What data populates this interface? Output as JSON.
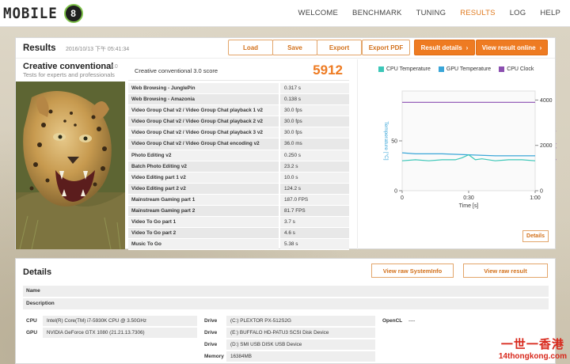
{
  "app": {
    "logo_text": "MOBILE",
    "logo_badge": "8"
  },
  "nav": [
    {
      "label": "WELCOME",
      "active": false
    },
    {
      "label": "BENCHMARK",
      "active": false
    },
    {
      "label": "TUNING",
      "active": false
    },
    {
      "label": "RESULTS",
      "active": true
    },
    {
      "label": "LOG",
      "active": false
    },
    {
      "label": "HELP",
      "active": false
    }
  ],
  "results": {
    "title": "Results",
    "date": "2016/10/13 下午 05:41:34",
    "buttons": {
      "load": "Load",
      "save": "Save",
      "export": "Export",
      "export_pdf": "Export PDF",
      "result_details": "Result details",
      "view_online": "View result online"
    },
    "test_name": "Creative conventional",
    "test_version": "3.0",
    "test_subtitle": "Tests for experts and professionals",
    "score_label": "Creative conventional 3.0 score",
    "score_value": "5912",
    "subtests": [
      {
        "name": "Web Browsing - JunglePin",
        "value": "0.317 s"
      },
      {
        "name": "Web Browsing - Amazonia",
        "value": "0.138 s"
      },
      {
        "name": "Video Group Chat v2 / Video Group Chat playback 1 v2",
        "value": "30.0 fps"
      },
      {
        "name": "Video Group Chat v2 / Video Group Chat playback 2 v2",
        "value": "30.0 fps"
      },
      {
        "name": "Video Group Chat v2 / Video Group Chat playback 3 v2",
        "value": "30.0 fps"
      },
      {
        "name": "Video Group Chat v2 / Video Group Chat encoding v2",
        "value": "36.0 ms"
      },
      {
        "name": "Photo Editing v2",
        "value": "0.250 s"
      },
      {
        "name": "Batch Photo Editing v2",
        "value": "23.2 s"
      },
      {
        "name": "Video Editing part 1 v2",
        "value": "10.0 s"
      },
      {
        "name": "Video Editing part 2 v2",
        "value": "124.2 s"
      },
      {
        "name": "Mainstream Gaming part 1",
        "value": "187.0 FPS"
      },
      {
        "name": "Mainstream Gaming part 2",
        "value": "81.7 FPS"
      },
      {
        "name": "Video To Go part 1",
        "value": "3.7 s"
      },
      {
        "name": "Video To Go part 2",
        "value": "4.6 s"
      },
      {
        "name": "Music To Go",
        "value": "5.38 s"
      }
    ],
    "details_button": "Details"
  },
  "chart_data": {
    "type": "line",
    "legend": [
      {
        "name": "CPU Temperature",
        "color": "#3cc7b8"
      },
      {
        "name": "GPU Temperature",
        "color": "#3aa6d8"
      },
      {
        "name": "CPU Clock",
        "color": "#8b4fb0"
      }
    ],
    "xlabel": "Time [s]",
    "ylabel_left": "Temperature [°C]",
    "ylabel_right": "Frequency [MHz]",
    "xlim": [
      0,
      1
    ],
    "x_ticks": [
      "0",
      "0:30",
      "1:00"
    ],
    "ylim_left": [
      0,
      100
    ],
    "y_ticks_left": [
      "0",
      "50"
    ],
    "ylim_right": [
      0,
      4400
    ],
    "y_ticks_right": [
      "0",
      "2000",
      "4000"
    ],
    "series": [
      {
        "name": "CPU Clock",
        "axis": "right",
        "x": [
          0,
          1
        ],
        "y": [
          3900,
          3900
        ]
      },
      {
        "name": "GPU Temperature",
        "axis": "left",
        "x": [
          0,
          0.1,
          0.3,
          0.5,
          0.7,
          0.9,
          1.0
        ],
        "y": [
          38,
          37,
          37,
          36,
          35,
          35,
          35
        ]
      },
      {
        "name": "CPU Temperature",
        "axis": "left",
        "x": [
          0,
          0.1,
          0.2,
          0.3,
          0.4,
          0.45,
          0.5,
          0.55,
          0.6,
          0.7,
          0.8,
          0.9,
          1.0
        ],
        "y": [
          30,
          31,
          30,
          31,
          31,
          33,
          36,
          31,
          32,
          30,
          31,
          31,
          30
        ]
      }
    ]
  },
  "details": {
    "title": "Details",
    "btn_systeminfo": "View raw SystemInfo",
    "btn_result": "View raw result",
    "name_label": "Name",
    "desc_label": "Description",
    "cpu_label": "CPU",
    "cpu_value": "Intel(R) Core(TM) i7-5930K CPU @ 3.50GHz",
    "gpu_label": "GPU",
    "gpu_value": "NVIDIA GeForce GTX 1080 (21.21.13.7306)",
    "drives_label": "Drive",
    "drive_1": "(C:) PLEXTOR PX-512S2G",
    "drive_2": "(E:) BUFFALO HD-PATU3 SCSI Disk Device",
    "drive_3": "(D:) SMI USB DISK USB Device",
    "memory_label": "Memory",
    "memory_value": "16384MB",
    "opencl_label": "OpenCL",
    "opencl_value": "----"
  },
  "watermark": {
    "line1": "一世一香港",
    "line2": "14thongkong.com"
  }
}
